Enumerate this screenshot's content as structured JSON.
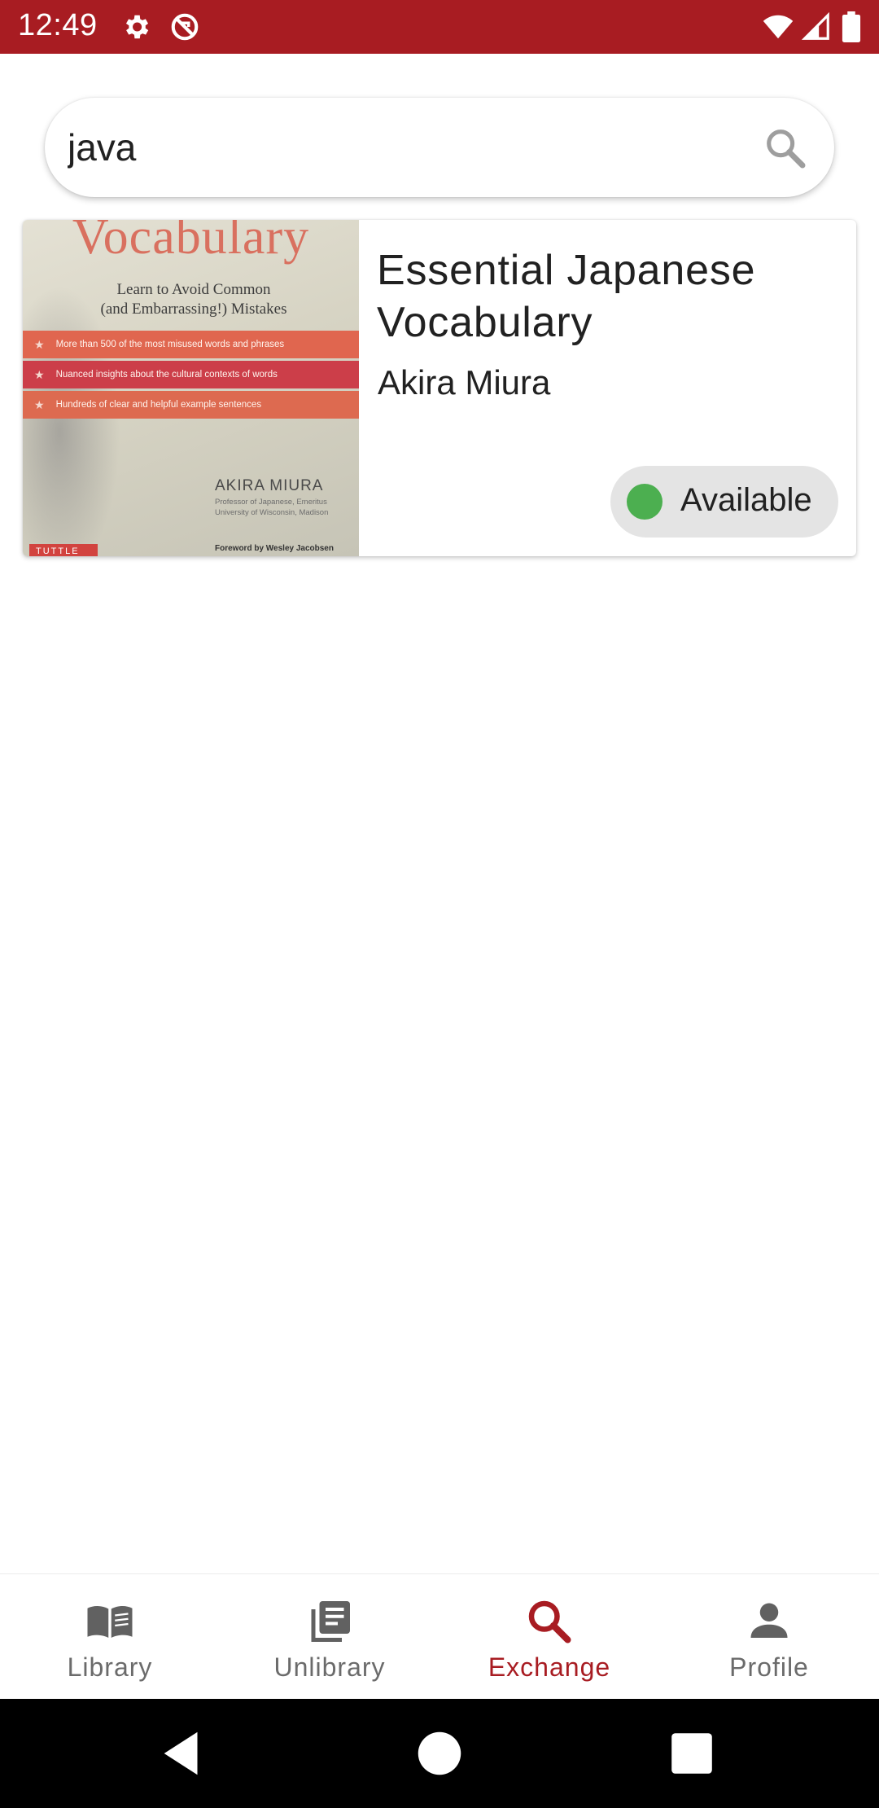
{
  "status_bar": {
    "time": "12:49",
    "icons": [
      "settings-gear-icon",
      "no-sync-icon",
      "wifi-icon",
      "cellular-signal-icon",
      "battery-icon"
    ],
    "background_color": "#a81c22"
  },
  "search": {
    "value": "java",
    "placeholder": "",
    "icon": "search-icon"
  },
  "results": [
    {
      "title": "Essential Japanese Vocabulary",
      "author": "Akira Miura",
      "availability": "Available",
      "availability_color": "#4caf50",
      "cover": {
        "title": "Vocabulary",
        "subtitle": "Learn to Avoid Common\n(and Embarrassing!) Mistakes",
        "bullets": [
          "More than 500 of the most misused words and phrases",
          "Nuanced insights about the cultural contexts of words",
          "Hundreds of clear and helpful example sentences"
        ],
        "author": "AKIRA MIURA",
        "affiliation": "Professor of Japanese, Emeritus\nUniversity of Wisconsin, Madison",
        "foreword": "Foreword by Wesley Jacobsen",
        "publisher": "TUTTLE"
      }
    }
  ],
  "bottom_nav": {
    "items": [
      {
        "label": "Library",
        "icon": "open-book-icon",
        "active": false
      },
      {
        "label": "Unlibrary",
        "icon": "article-stack-icon",
        "active": false
      },
      {
        "label": "Exchange",
        "icon": "search-icon",
        "active": true
      },
      {
        "label": "Profile",
        "icon": "person-icon",
        "active": false
      }
    ],
    "active_color": "#a81c22"
  },
  "system_nav": {
    "buttons": [
      "back-icon",
      "home-icon",
      "recents-icon"
    ]
  }
}
